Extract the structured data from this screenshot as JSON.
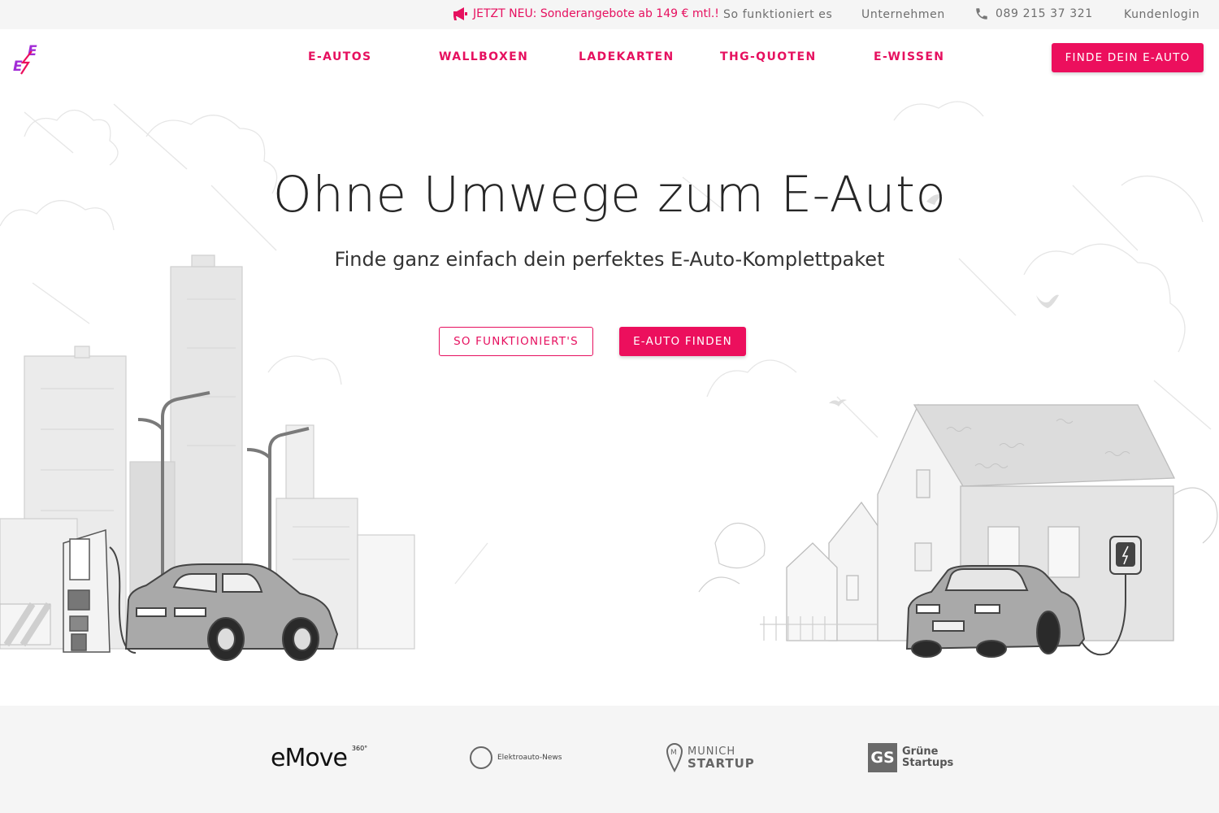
{
  "colors": {
    "accent": "#ec0f5d",
    "accent_text": "#e6105f",
    "topbar_bg": "#f5f5f5",
    "text_muted": "#6e6e6e"
  },
  "topbar": {
    "promo_icon": "megaphone-icon",
    "promo_text": "JETZT NEU: Sonderangebote ab 149 € mtl.!",
    "how_it_works": "So funktioniert es",
    "business": "Unternehmen",
    "phone_icon": "phone-icon",
    "phone": "089 215 37 321",
    "login": "Kundenlogin"
  },
  "nav": {
    "logo_text": "EE",
    "items": [
      {
        "label": "E-AUTOS"
      },
      {
        "label": "WALLBOXEN"
      },
      {
        "label": "LADEKARTEN"
      },
      {
        "label": "THG-QUOTEN"
      },
      {
        "label": "E-WISSEN"
      }
    ],
    "cta": "FINDE DEIN E-AUTO"
  },
  "hero": {
    "title": "Ohne Umwege zum E-Auto",
    "subtitle": "Finde ganz einfach dein perfektes E-Auto-Komplettpaket",
    "btn_secondary": "SO FUNKTIONIERT'S",
    "btn_primary": "E-AUTO FINDEN"
  },
  "press": {
    "emove": "eMove",
    "emove_sup": "360°",
    "elektroauto_news": "Elektroauto-News",
    "munich_top": "MUNICH",
    "munich_bottom": "STARTUP",
    "gruene_box": "GS",
    "gruene_line1": "Grüne",
    "gruene_line2": "Startups"
  }
}
